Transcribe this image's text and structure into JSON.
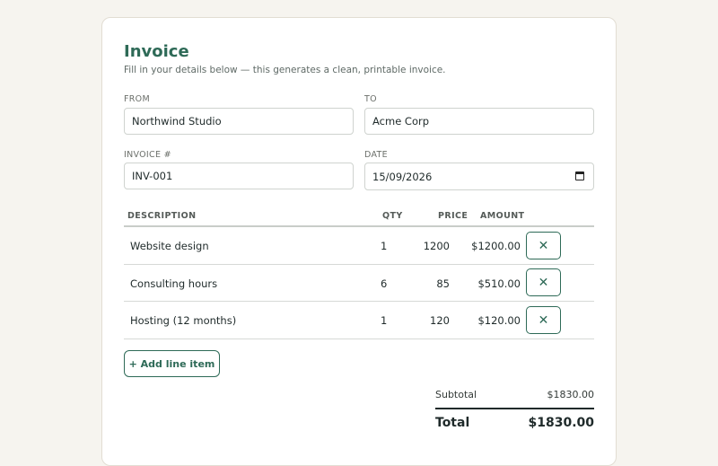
{
  "header": {
    "title": "Invoice",
    "subtitle": "Fill in your details below — this generates a clean, printable invoice."
  },
  "form": {
    "from_label": "FROM",
    "from_value": "Northwind Studio",
    "to_label": "TO",
    "to_value": "Acme Corp",
    "invoice_label": "INVOICE #",
    "invoice_value": "INV-001",
    "date_label": "DATE",
    "date_value": "15/09/2026"
  },
  "table": {
    "headers": [
      "DESCRIPTION",
      "QTY",
      "PRICE",
      "AMOUNT"
    ],
    "rows": [
      {
        "description": "Website design",
        "qty": "1",
        "price": "1200",
        "amount": "$1200.00"
      },
      {
        "description": "Consulting hours",
        "qty": "6",
        "price": "85",
        "amount": "$510.00"
      },
      {
        "description": "Hosting (12 months)",
        "qty": "1",
        "price": "120",
        "amount": "$120.00"
      }
    ],
    "remove_glyph": "✕"
  },
  "actions": {
    "add_line_item": "+ Add line item"
  },
  "summary": {
    "subtotal_label": "Subtotal",
    "subtotal_value": "$1830.00",
    "total_label": "Total",
    "total_value": "$1830.00"
  },
  "colors": {
    "accent": "#2e6a57",
    "background": "#f6f4ef"
  },
  "icons": {
    "remove": "close-icon",
    "date_picker": "calendar-icon"
  }
}
